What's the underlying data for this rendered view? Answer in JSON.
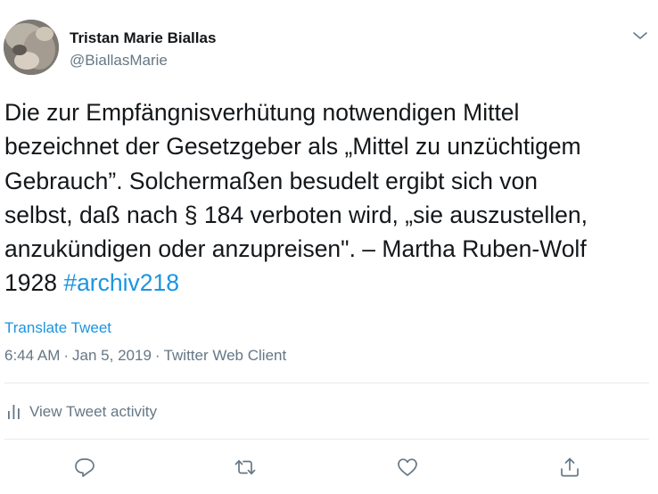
{
  "author": {
    "display_name": "Tristan Marie Biallas",
    "handle": "@BiallasMarie",
    "avatar_icon": "avatar-photo"
  },
  "tweet": {
    "lines": [
      "Die zur Empfängnisverhütung notwendigen Mittel",
      "bezeichnet der Gesetzgeber als „Mittel zu unzüchtigem",
      "Gebrauch”.  Solchermaßen besudelt ergibt sich von",
      "selbst, daß nach § 184 verboten wird, „sie auszustellen,",
      "anzukündigen oder anzupreisen\". – Martha Ruben-Wolf"
    ],
    "last_line_prefix": "1928 ",
    "hashtag": "#archiv218"
  },
  "translate_label": "Translate Tweet",
  "meta": {
    "time": "6:44 AM",
    "separator": "·",
    "date": "Jan 5, 2019",
    "client": "Twitter Web Client"
  },
  "activity_label": "View Tweet activity",
  "actions": {
    "reply_icon": "reply-icon",
    "retweet_icon": "retweet-icon",
    "like_icon": "like-icon",
    "share_icon": "share-icon"
  },
  "colors": {
    "text": "#14171a",
    "secondary": "#657786",
    "link": "#1b95e0",
    "divider": "#e6ecf0"
  }
}
